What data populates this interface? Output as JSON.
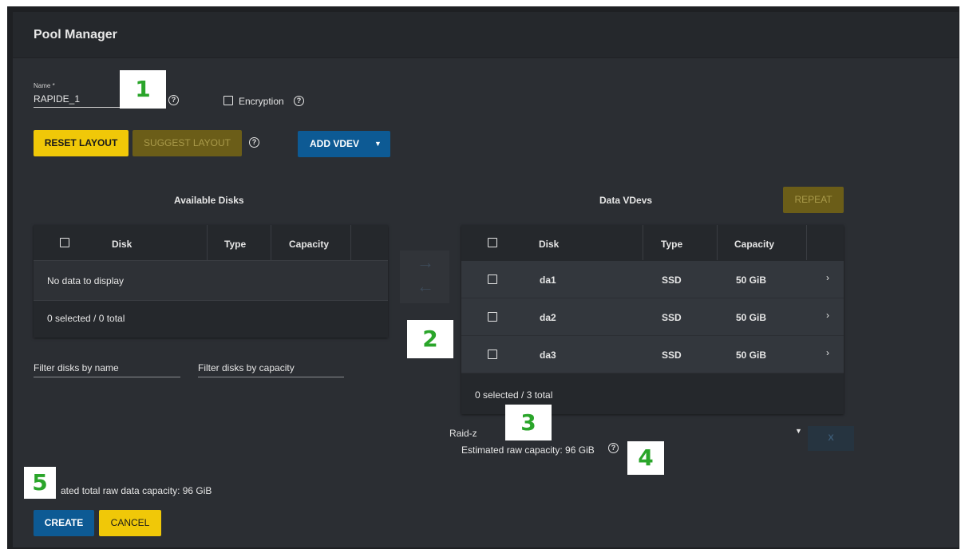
{
  "title": "Pool Manager",
  "name_field": {
    "label": "Name *",
    "value": "RAPIDE_1"
  },
  "encryption_label": "Encryption",
  "buttons": {
    "reset_layout": "RESET LAYOUT",
    "suggest_layout": "SUGGEST LAYOUT",
    "add_vdev": "ADD VDEV",
    "repeat": "REPEAT",
    "create": "CREATE",
    "cancel": "CANCEL",
    "remove_vdev": "X"
  },
  "available_disks": {
    "title": "Available Disks",
    "columns": [
      "Disk",
      "Type",
      "Capacity"
    ],
    "empty_message": "No data to display",
    "footer": "0 selected / 0 total"
  },
  "filters": {
    "name_placeholder": "Filter disks by name",
    "capacity_placeholder": "Filter disks by capacity"
  },
  "data_vdevs": {
    "title": "Data VDevs",
    "columns": [
      "Disk",
      "Type",
      "Capacity"
    ],
    "rows": [
      {
        "disk": "da1",
        "type": "SSD",
        "capacity": "50 GiB"
      },
      {
        "disk": "da2",
        "type": "SSD",
        "capacity": "50 GiB"
      },
      {
        "disk": "da3",
        "type": "SSD",
        "capacity": "50 GiB"
      }
    ],
    "footer": "0 selected / 3 total",
    "layout_value": "Raid-z",
    "estimated_capacity": "Estimated raw capacity: 96 GiB"
  },
  "total_capacity": "ated total raw data capacity: 96 GiB",
  "annotations": [
    "1",
    "2",
    "3",
    "4",
    "5"
  ],
  "colors": {
    "background": "#2b2e33",
    "header": "#25282c",
    "yellow": "#f0c808",
    "yellow_disabled": "#6b5d18",
    "blue": "#0d5a94",
    "annotation_text": "#2aa52a"
  }
}
